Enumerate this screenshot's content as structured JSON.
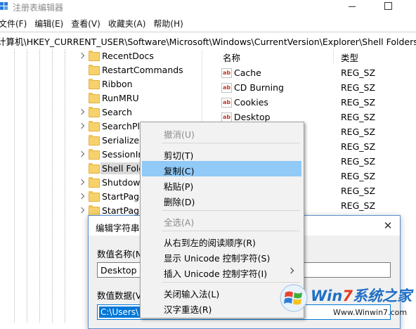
{
  "window": {
    "title": "注册表编辑器"
  },
  "menubar": [
    "文件(F)",
    "编辑(E)",
    "查看(V)",
    "收藏夹(A)",
    "帮助(H)"
  ],
  "address": "计算机\\HKEY_CURRENT_USER\\Software\\Microsoft\\Windows\\CurrentVersion\\Explorer\\Shell Folders",
  "tree": {
    "items": [
      {
        "label": "RecentDocs",
        "expandable": true
      },
      {
        "label": "RestartCommands",
        "expandable": false
      },
      {
        "label": "Ribbon",
        "expandable": false
      },
      {
        "label": "RunMRU",
        "expandable": false
      },
      {
        "label": "Search",
        "expandable": true
      },
      {
        "label": "SearchPla",
        "expandable": true
      },
      {
        "label": "Serialize",
        "expandable": false
      },
      {
        "label": "SessionIn",
        "expandable": true
      },
      {
        "label": "Shell Folc",
        "expandable": false,
        "selected": true
      },
      {
        "label": "Shutdown",
        "expandable": false
      },
      {
        "label": "StartPage",
        "expandable": false
      },
      {
        "label": "StartPage",
        "expandable": false
      }
    ]
  },
  "list": {
    "headers": {
      "name": "名称",
      "type": "类型"
    },
    "rows": [
      {
        "name": "Cache",
        "type": "REG_SZ"
      },
      {
        "name": "CD Burning",
        "type": "REG_SZ"
      },
      {
        "name": "Cookies",
        "type": "REG_SZ"
      },
      {
        "name": "Desktop",
        "type": "REG_SZ"
      },
      {
        "name": "",
        "type": "REG_SZ"
      },
      {
        "name": "",
        "type": "REG_SZ"
      },
      {
        "name": "",
        "type": "REG_SZ"
      },
      {
        "name": "",
        "type": "REG_SZ"
      },
      {
        "name": "",
        "type": "REG_SZ"
      },
      {
        "name": "",
        "type": "REG_SZ"
      }
    ]
  },
  "dialog": {
    "title": "编辑字符串",
    "name_label": "数值名称(N",
    "name_value": "Desktop",
    "data_label": "数值数据(V",
    "data_value": "C:\\Users\\"
  },
  "context_menu": {
    "items": [
      {
        "label": "撤消(U)",
        "disabled": true
      },
      {
        "sep": true
      },
      {
        "label": "剪切(T)"
      },
      {
        "label": "复制(C)",
        "highlighted": true
      },
      {
        "label": "粘贴(P)"
      },
      {
        "label": "删除(D)"
      },
      {
        "sep": true
      },
      {
        "label": "全选(A)",
        "disabled": true
      },
      {
        "sep": true
      },
      {
        "label": "从右到左的阅读顺序(R)"
      },
      {
        "label": "显示 Unicode 控制字符(S)"
      },
      {
        "label": "插入 Unicode 控制字符(I)",
        "submenu": true
      },
      {
        "sep": true
      },
      {
        "label": "关闭输入法(L)"
      },
      {
        "label": "汉字重选(R)"
      }
    ]
  },
  "watermark": {
    "brand_a": "Win",
    "brand_7": "7",
    "brand_b": "系统之家",
    "url": "Www.Winwin7.com"
  },
  "colors": {
    "accent": "#0078d7",
    "highlight": "#91c9f7",
    "selection": "#d9d9d9"
  }
}
